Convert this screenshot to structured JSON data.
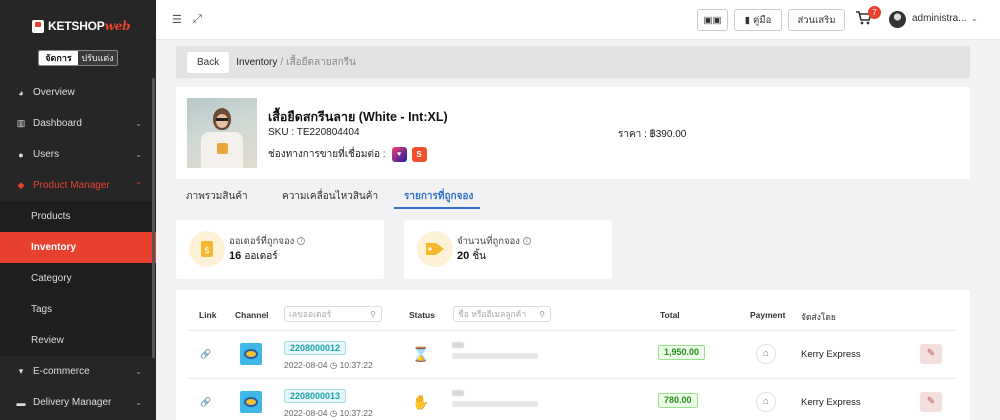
{
  "app": {
    "logo_main": "KETSHOP",
    "logo_accent": "web",
    "mode_active": "จัดการ",
    "mode_inactive": "ปรับแต่ง"
  },
  "sidebar": {
    "items": [
      {
        "label": "Overview",
        "icon": "pie-chart-icon"
      },
      {
        "label": "Dashboard",
        "icon": "bar-chart-icon"
      },
      {
        "label": "Users",
        "icon": "users-icon"
      },
      {
        "label": "Product Manager",
        "icon": "tag-icon"
      }
    ],
    "submenu": [
      "Products",
      "Inventory",
      "Category",
      "Tags",
      "Review"
    ],
    "bottom_items": [
      {
        "label": "E-commerce",
        "icon": "cart-icon"
      },
      {
        "label": "Delivery Manager",
        "icon": "truck-icon"
      }
    ]
  },
  "topbar": {
    "manual_label": "คู่มือ",
    "addon_label": "ส่วนเสริม",
    "cart_count": "7",
    "user_name": "administra..."
  },
  "breadcrumb": {
    "back": "Back",
    "section": "Inventory",
    "separator": "/",
    "current": "เสื้อยืดลายสกรีน"
  },
  "product": {
    "title": "เสื้อยืดสกรีนลาย (White - Int:XL)",
    "sku": "SKU : TE220804404",
    "channel_label": "ช่องทางการขายที่เชื่อมต่อ :",
    "price": "ราคา : ฿390.00"
  },
  "tabs": [
    "ภาพรวมสินค้า",
    "ความเคลื่อนไหวสินค้า",
    "รายการที่ถูกจอง"
  ],
  "stats": {
    "orders_label": "ออเดอร์ที่ถูกจอง",
    "orders_value": "16",
    "orders_unit": "ออเดอร์",
    "qty_label": "จำนวนที่ถูกจอง",
    "qty_value": "20",
    "qty_unit": "ชิ้น"
  },
  "table": {
    "headers": {
      "link": "Link",
      "channel": "Channel",
      "order_search_placeholder": "เลขออเดอร์",
      "status": "Status",
      "customer_search_placeholder": "ชื่อ หรืออีเมลลูกค้า",
      "total": "Total",
      "payment": "Payment",
      "shipping": "จัดส่งโดย"
    },
    "rows": [
      {
        "order_no": "2208000012",
        "date": "2022-08-04",
        "time": "10:37:22",
        "total": "1,950.00",
        "shipping": "Kerry Express",
        "status_icon": "hourglass-icon"
      },
      {
        "order_no": "2208000013",
        "date": "2022-08-04",
        "time": "10:37:22",
        "total": "780.00",
        "shipping": "Kerry Express",
        "status_icon": "hand-coin-icon"
      }
    ]
  }
}
